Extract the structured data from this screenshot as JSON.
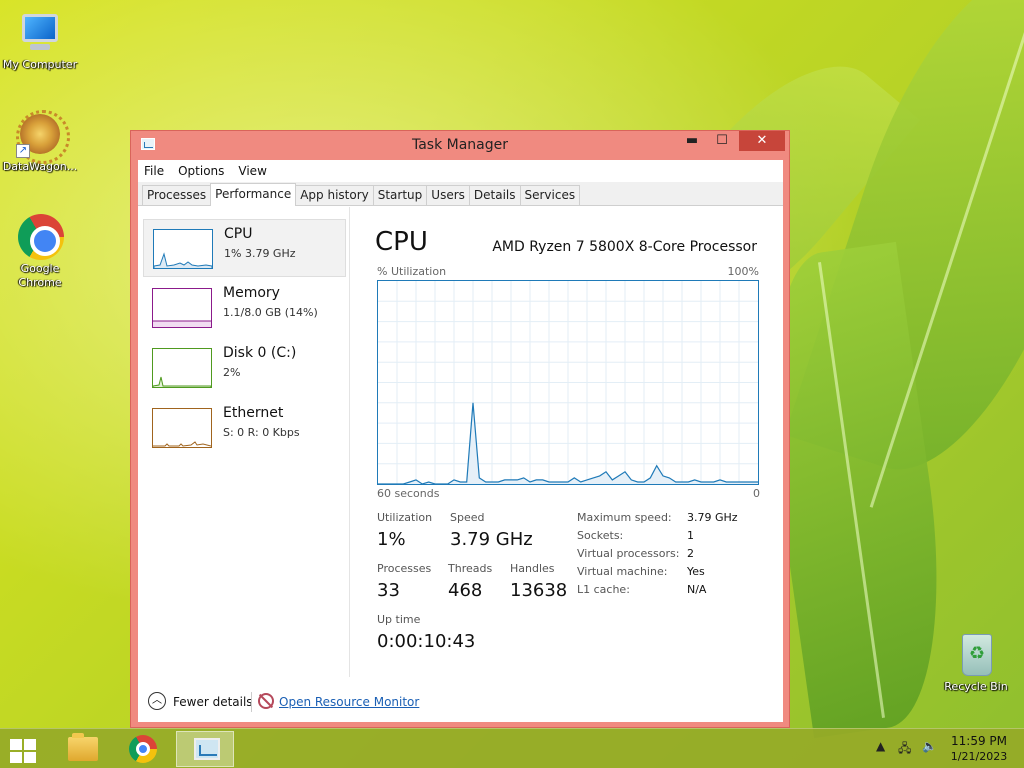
{
  "desktop": {
    "icons": [
      {
        "label": "My Computer"
      },
      {
        "label": "DataWagon..."
      },
      {
        "label": "Google Chrome"
      },
      {
        "label": "Recycle Bin"
      }
    ]
  },
  "window": {
    "title": "Task Manager",
    "controls": {
      "minimize": "▬",
      "maximize": "☐",
      "close": "✕"
    },
    "menu": [
      "File",
      "Options",
      "View"
    ],
    "tabs": [
      "Processes",
      "Performance",
      "App history",
      "Startup",
      "Users",
      "Details",
      "Services"
    ],
    "active_tab": "Performance"
  },
  "resources": [
    {
      "name": "CPU",
      "detail": "1% 3.79 GHz",
      "color": "#1f7ab8"
    },
    {
      "name": "Memory",
      "detail": "1.1/8.0 GB (14%)",
      "color": "#8b1a8b"
    },
    {
      "name": "Disk 0 (C:)",
      "detail": "2%",
      "color": "#4f9a1f"
    },
    {
      "name": "Ethernet",
      "detail": "S: 0 R: 0 Kbps",
      "color": "#a0641e"
    }
  ],
  "cpu": {
    "title": "CPU",
    "model": "AMD Ryzen 7 5800X 8-Core Processor",
    "graph_top_left": "% Utilization",
    "graph_top_right": "100%",
    "graph_bottom_left": "60 seconds",
    "graph_bottom_right": "0",
    "utilization_points": [
      0,
      0,
      0,
      0,
      0,
      1,
      2,
      0,
      1,
      0,
      0,
      0,
      2,
      1,
      1,
      40,
      3,
      1,
      1,
      1,
      2,
      2,
      2,
      3,
      1,
      2,
      2,
      1,
      1,
      1,
      1,
      3,
      1,
      2,
      3,
      4,
      6,
      2,
      4,
      6,
      2,
      1,
      1,
      3,
      9,
      4,
      3,
      1,
      1,
      1,
      2,
      1,
      1,
      1,
      2,
      1,
      1,
      1,
      1,
      1,
      1
    ],
    "stats": {
      "utilization_label": "Utilization",
      "utilization": "1%",
      "speed_label": "Speed",
      "speed": "3.79 GHz",
      "processes_label": "Processes",
      "processes": "33",
      "threads_label": "Threads",
      "threads": "468",
      "handles_label": "Handles",
      "handles": "13638",
      "uptime_label": "Up time",
      "uptime": "0:00:10:43"
    },
    "specs": [
      {
        "k": "Maximum speed:",
        "v": "3.79 GHz"
      },
      {
        "k": "Sockets:",
        "v": "1"
      },
      {
        "k": "Virtual processors:",
        "v": "2"
      },
      {
        "k": "Virtual machine:",
        "v": "Yes"
      },
      {
        "k": "L1 cache:",
        "v": "N/A"
      }
    ]
  },
  "footer": {
    "fewer_details": "Fewer details",
    "open_resource_monitor": "Open Resource Monitor"
  },
  "taskbar": {
    "time": "11:59 PM",
    "date": "1/21/2023"
  }
}
